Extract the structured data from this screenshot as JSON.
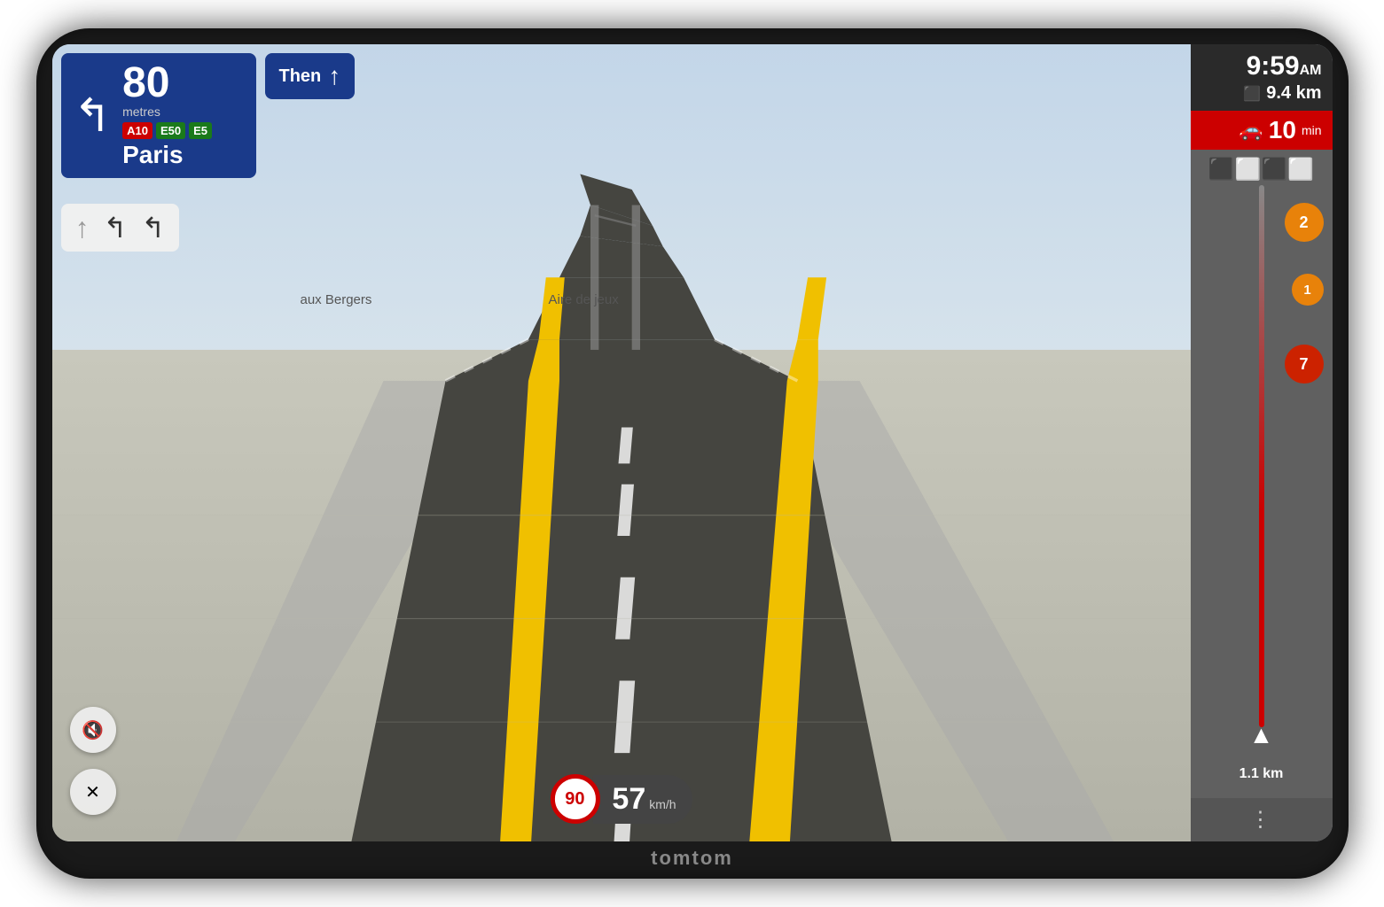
{
  "device": {
    "brand": "tomtom"
  },
  "header": {
    "eta_time": "9:59",
    "eta_ampm": "AM",
    "eta_distance": "9.4 km",
    "eta_travel_time": "10",
    "eta_travel_unit": "min"
  },
  "navigation": {
    "distance_number": "80",
    "distance_unit": "metres",
    "road_signs": [
      "A10",
      "E50",
      "E5"
    ],
    "destination": "Paris",
    "then_label": "Then",
    "lane_arrows": [
      "↑",
      "↰",
      "↰"
    ]
  },
  "map": {
    "label1": "aux Bergers",
    "label2": "Aire de jeux"
  },
  "speed": {
    "limit": "90",
    "current": "57",
    "unit": "km/h"
  },
  "traffic": {
    "badge1_value": "2",
    "badge2_value": "1",
    "badge3_value": "7",
    "position_distance": "1.1 km"
  },
  "controls": {
    "mute_icon": "🔇",
    "cancel_icon": "✕",
    "more_icon": "⋮"
  }
}
